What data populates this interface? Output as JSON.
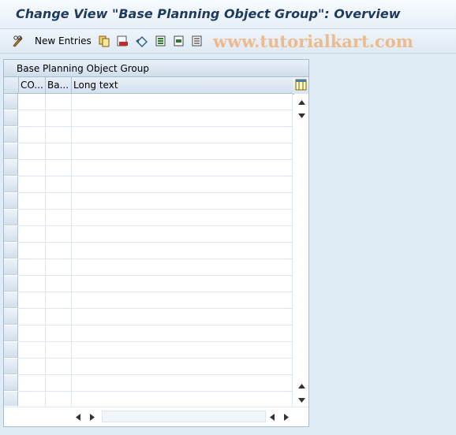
{
  "window": {
    "title": "Change View \"Base Planning Object Group\": Overview"
  },
  "toolbar": {
    "icons": [
      "pencil-glasses-icon",
      "copy-icon",
      "delete-icon",
      "undo-icon",
      "select-all-icon",
      "select-block-icon",
      "deselect-all-icon"
    ],
    "new_entries_label": "New Entries"
  },
  "watermark": {
    "text": "www.tutorialkart.com",
    "color": "#f0b27a"
  },
  "table": {
    "title": "Base Planning Object Group",
    "columns": [
      "CO...",
      "Ba...",
      "Long text"
    ],
    "row_count": 19
  },
  "colors": {
    "background": "#dfebf5",
    "title": "#1e3a5c",
    "header": "#cfdeec"
  }
}
